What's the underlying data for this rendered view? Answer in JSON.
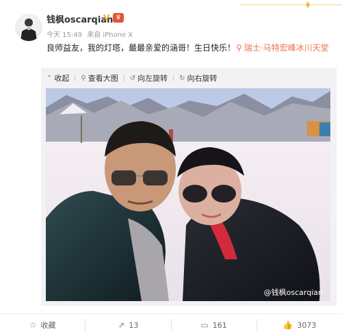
{
  "post": {
    "username": "钱枫oscarqian",
    "badge_v": "V",
    "badge_vip": "♛",
    "time": "今天 15:49",
    "source": "来自 iPhone X",
    "text": "良师益友，我的灯塔，最最亲爱的涵哥！生日快乐！",
    "location": "瑞士·马特宏峰冰川天堂"
  },
  "toolbar": {
    "collapse": "收起",
    "view_large": "查看大图",
    "rotate_left": "向左旋转",
    "rotate_right": "向右旋转"
  },
  "photo": {
    "watermark": "@钱枫oscarqian"
  },
  "footer": {
    "favorite": "收藏",
    "repost": "13",
    "comment": "161",
    "like": "3073"
  },
  "colors": {
    "accent": "#eb7350",
    "verified": "#f5a623"
  }
}
